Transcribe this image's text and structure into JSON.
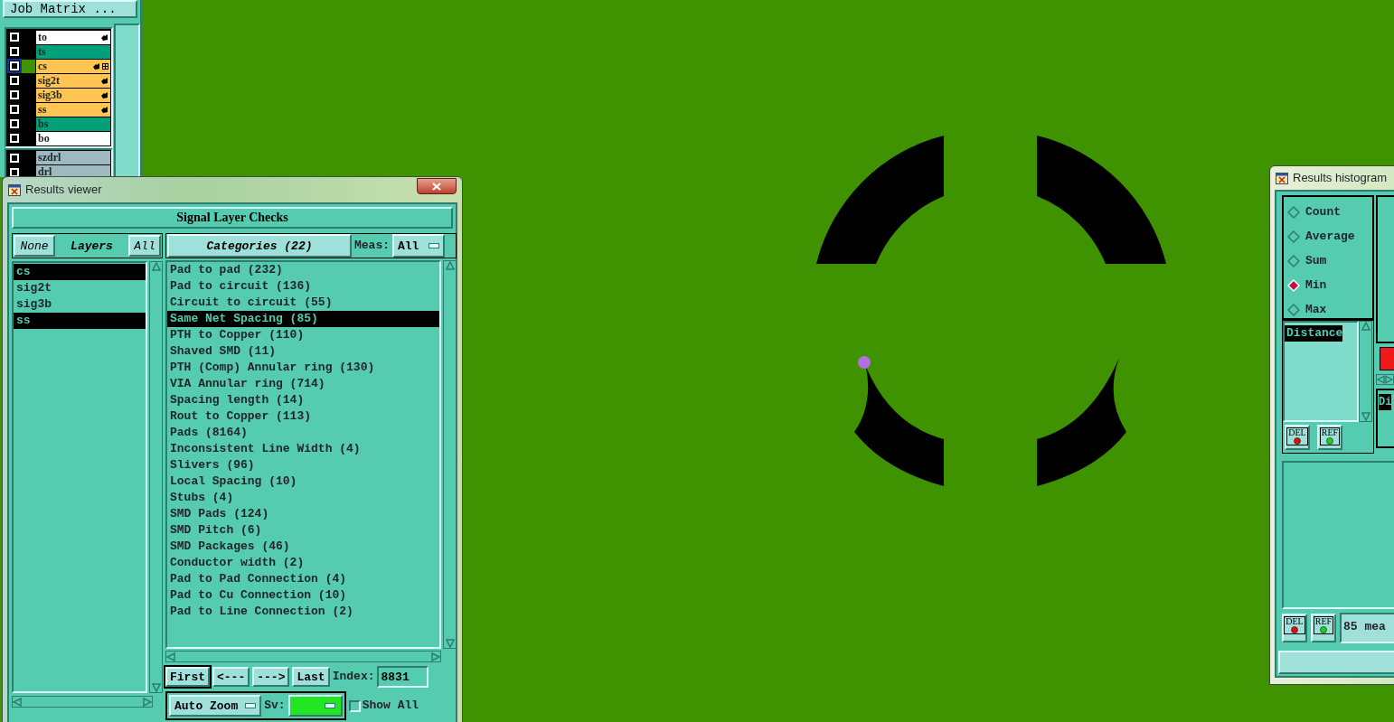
{
  "job_matrix": {
    "title": "Job Matrix ...",
    "layers": [
      {
        "name": "to",
        "color": "#ffffff",
        "checked": false,
        "selected": false,
        "affected": true,
        "linked": false
      },
      {
        "name": "ts",
        "color": "#00a07a",
        "checked": false,
        "selected": false,
        "affected": false,
        "linked": false
      },
      {
        "name": "cs",
        "color": "#ffc553",
        "checked": false,
        "selected": true,
        "affected": true,
        "linked": true
      },
      {
        "name": "sig2t",
        "color": "#ffc553",
        "checked": false,
        "selected": false,
        "affected": true,
        "linked": false
      },
      {
        "name": "sig3b",
        "color": "#ffc553",
        "checked": false,
        "selected": false,
        "affected": true,
        "linked": false
      },
      {
        "name": "ss",
        "color": "#ffc553",
        "checked": false,
        "selected": false,
        "affected": true,
        "linked": false
      },
      {
        "name": "bs",
        "color": "#00a07a",
        "checked": false,
        "selected": false,
        "affected": false,
        "linked": false
      },
      {
        "name": "bo",
        "color": "#ffffff",
        "checked": false,
        "selected": false,
        "affected": false,
        "linked": false
      }
    ],
    "drill_layers": [
      {
        "name": "szdrl",
        "color": "#9fb9c0",
        "checked": false
      },
      {
        "name": "drl",
        "color": "#9fb9c0",
        "checked": false
      }
    ]
  },
  "results_viewer": {
    "title": "Results viewer",
    "heading": "Signal Layer Checks",
    "layer_buttons": [
      "None",
      "Layers",
      "All"
    ],
    "layers": [
      {
        "name": "cs",
        "selected": true
      },
      {
        "name": "sig2t",
        "selected": false
      },
      {
        "name": "sig3b",
        "selected": false
      },
      {
        "name": "ss",
        "selected": true
      }
    ],
    "categories_button": "Categories (22)",
    "meas_label": "Meas:",
    "meas_value": "All",
    "categories": [
      {
        "label": "Pad to pad (232)",
        "selected": false
      },
      {
        "label": "Pad to circuit (136)",
        "selected": false
      },
      {
        "label": "Circuit to circuit (55)",
        "selected": false
      },
      {
        "label": "Same Net Spacing (85)",
        "selected": true
      },
      {
        "label": "PTH to Copper (110)",
        "selected": false
      },
      {
        "label": "Shaved SMD (11)",
        "selected": false
      },
      {
        "label": "PTH (Comp) Annular ring (130)",
        "selected": false
      },
      {
        "label": "VIA Annular ring (714)",
        "selected": false
      },
      {
        "label": "Spacing length (14)",
        "selected": false
      },
      {
        "label": "Rout to Copper (113)",
        "selected": false
      },
      {
        "label": "Pads (8164)",
        "selected": false
      },
      {
        "label": "Inconsistent Line Width (4)",
        "selected": false
      },
      {
        "label": "Slivers (96)",
        "selected": false
      },
      {
        "label": "Local Spacing (10)",
        "selected": false
      },
      {
        "label": "Stubs (4)",
        "selected": false
      },
      {
        "label": "SMD Pads (124)",
        "selected": false
      },
      {
        "label": "SMD Pitch (6)",
        "selected": false
      },
      {
        "label": "SMD Packages (46)",
        "selected": false
      },
      {
        "label": "Conductor width (2)",
        "selected": false
      },
      {
        "label": "Pad to Pad Connection (4)",
        "selected": false
      },
      {
        "label": "Pad to Cu Connection (10)",
        "selected": false
      },
      {
        "label": "Pad to Line Connection (2)",
        "selected": false
      }
    ],
    "nav_buttons": [
      "First",
      "<---",
      "--->",
      "Last"
    ],
    "index_label": "Index:",
    "index_value": "8831",
    "zoom_mode": "Auto Zoom",
    "sv_label": "Sv:",
    "show_all": {
      "label": "Show All",
      "checked": false
    }
  },
  "histogram": {
    "title": "Results histogram",
    "options": [
      {
        "label": "Count",
        "selected": false
      },
      {
        "label": "Average",
        "selected": false
      },
      {
        "label": "Sum",
        "selected": false
      },
      {
        "label": "Min",
        "selected": true
      },
      {
        "label": "Max",
        "selected": false
      }
    ],
    "measures": [
      {
        "label": "Distance",
        "selected": true
      }
    ],
    "column_2_text": "Di",
    "buttons": [
      "DEL",
      "REF",
      "DEL",
      "REF"
    ],
    "status": "85 mea"
  }
}
